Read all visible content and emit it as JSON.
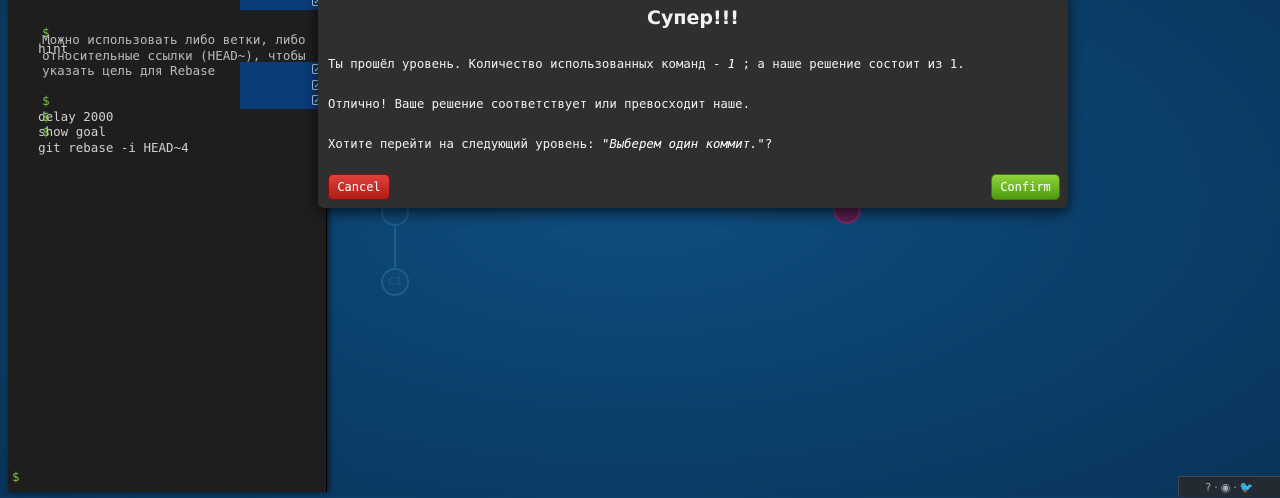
{
  "terminal": {
    "lines": [
      {
        "cmd": "hint"
      },
      {
        "note": "Можно использовать либо ветки, либо"
      },
      {
        "note": "относительные ссылки (HEAD~), чтобы"
      },
      {
        "note": "указать цель для Rebase"
      },
      {
        "cmd": "delay 2000"
      },
      {
        "cmd": "show goal"
      },
      {
        "cmd": "git rebase -i HEAD~4"
      }
    ],
    "prompt": "$",
    "check_glyph": "✓"
  },
  "tree": {
    "node_label": "C1"
  },
  "modal": {
    "title": "Супер!!!",
    "line1_a": "Ты прошёл уровень. Количество использованных команд - ",
    "line1_b": "1",
    "line1_c": " ; а наше решение состоит из 1.",
    "line2": "Отлично! Ваше решение соответствует или превосходит наше.",
    "line3_a": "Хотите перейти на следующий уровень: ",
    "line3_b": "\"Выберем один коммит.\"",
    "line3_c": "?",
    "cancel": "Cancel",
    "confirm": "Confirm"
  },
  "toolbar": {
    "help": "?",
    "globe": "◉",
    "twitter": "🐦"
  },
  "colors": {
    "background": "#0b3f6a",
    "cancel": "#c62a24",
    "confirm": "#6cb520",
    "terminal": "#1e1e1e"
  }
}
